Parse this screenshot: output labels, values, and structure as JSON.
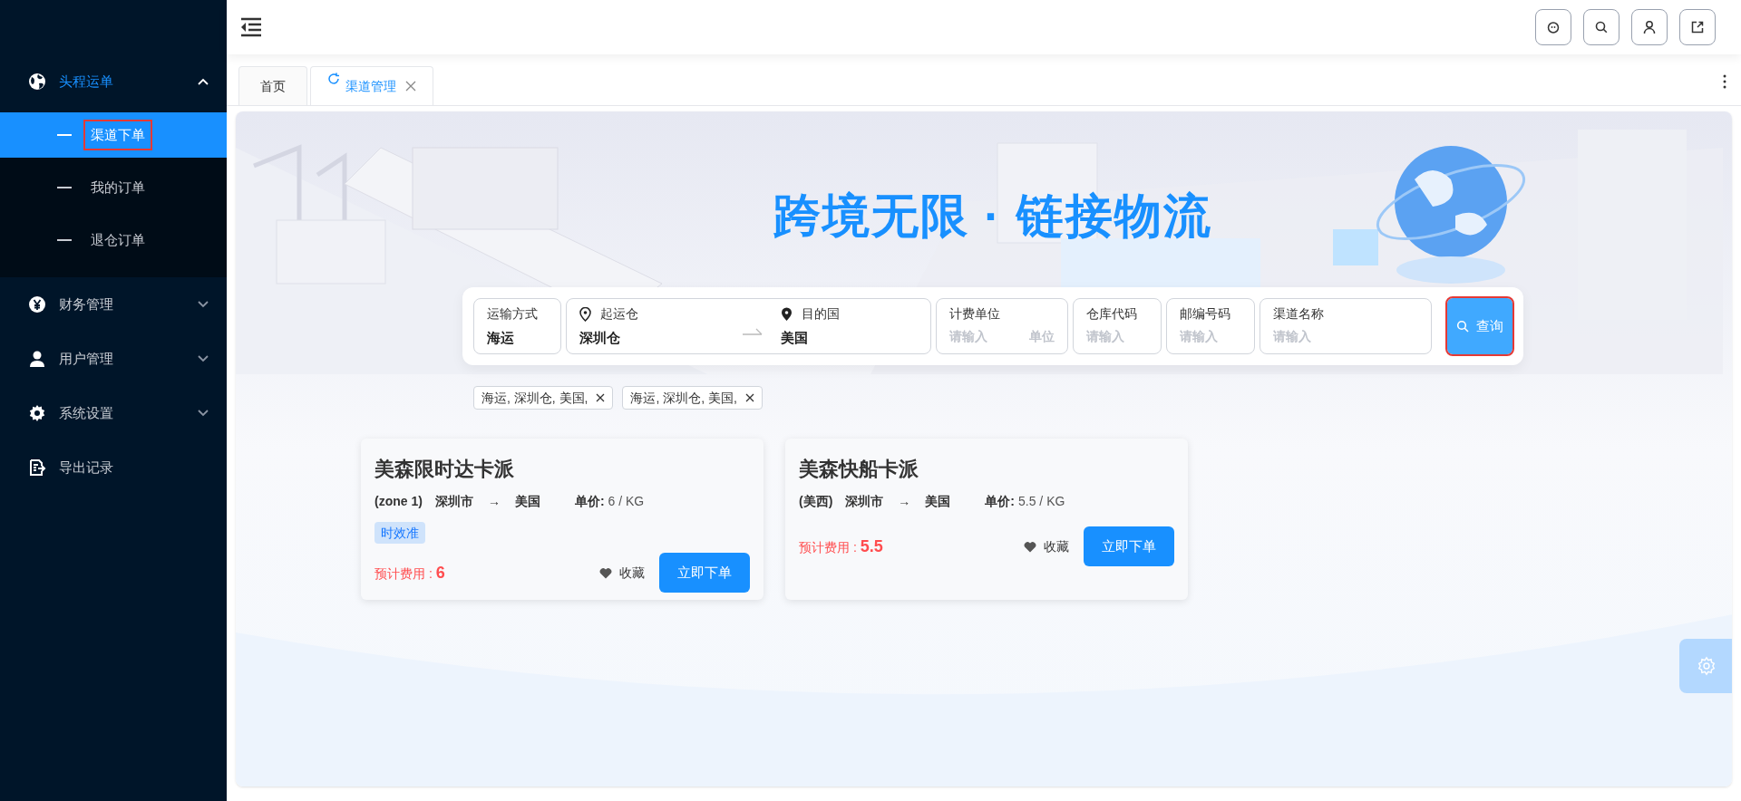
{
  "sidebar": {
    "items": [
      {
        "label": "头程运单",
        "expanded": true,
        "selected": true,
        "children": [
          {
            "label": "渠道下单",
            "selected": true,
            "highlighted": true
          },
          {
            "label": "我的订单",
            "selected": false,
            "highlighted": false
          },
          {
            "label": "退仓订单",
            "selected": false,
            "highlighted": false
          }
        ]
      },
      {
        "label": "财务管理",
        "expanded": false,
        "selected": false
      },
      {
        "label": "用户管理",
        "expanded": false,
        "selected": false
      },
      {
        "label": "系统设置",
        "expanded": false,
        "selected": false
      },
      {
        "label": "导出记录",
        "selected": false
      }
    ]
  },
  "tabs": [
    {
      "label": "首页",
      "selected": false,
      "closable": false
    },
    {
      "label": "渠道管理",
      "selected": true,
      "closable": true
    }
  ],
  "banner": {
    "title": "跨境无限 · 链接物流"
  },
  "search": {
    "fields": [
      {
        "kind": "select",
        "label": "运输方式",
        "value": "海运"
      },
      {
        "kind": "route",
        "from_label": "起运仓",
        "from_value": "深圳仓",
        "to_label": "目的国",
        "to_value": "美国"
      },
      {
        "kind": "unit",
        "label": "计费单位",
        "placeholder": "请输入",
        "suffix": "单位"
      },
      {
        "kind": "input",
        "label": "仓库代码",
        "placeholder": "请输入"
      },
      {
        "kind": "input",
        "label": "邮编号码",
        "placeholder": "请输入"
      },
      {
        "kind": "input",
        "label": "渠道名称",
        "placeholder": "请输入",
        "wide": true
      }
    ],
    "button": {
      "label": "查询",
      "highlighted": true
    }
  },
  "history_tags": [
    "海运, 深圳仓, 美国,",
    "海运, 深圳仓, 美国,"
  ],
  "cards": [
    {
      "title": "美森限时达卡派",
      "zone": "(zone 1)",
      "from": "深圳市",
      "arrow": "→",
      "to": "美国",
      "price_label": "单价:",
      "price": "6 / KG",
      "tags": [
        "时效准"
      ],
      "cost_label": "预计费用 :",
      "cost": "6",
      "favorite_label": "收藏",
      "order_label": "立即下单"
    },
    {
      "title": "美森快船卡派",
      "zone": "(美西)",
      "from": "深圳市",
      "arrow": "→",
      "to": "美国",
      "price_label": "单价:",
      "price": "5.5 / KG",
      "cost_label": "预计费用 :",
      "cost": "5.5",
      "favorite_label": "收藏",
      "order_label": "立即下单"
    }
  ]
}
